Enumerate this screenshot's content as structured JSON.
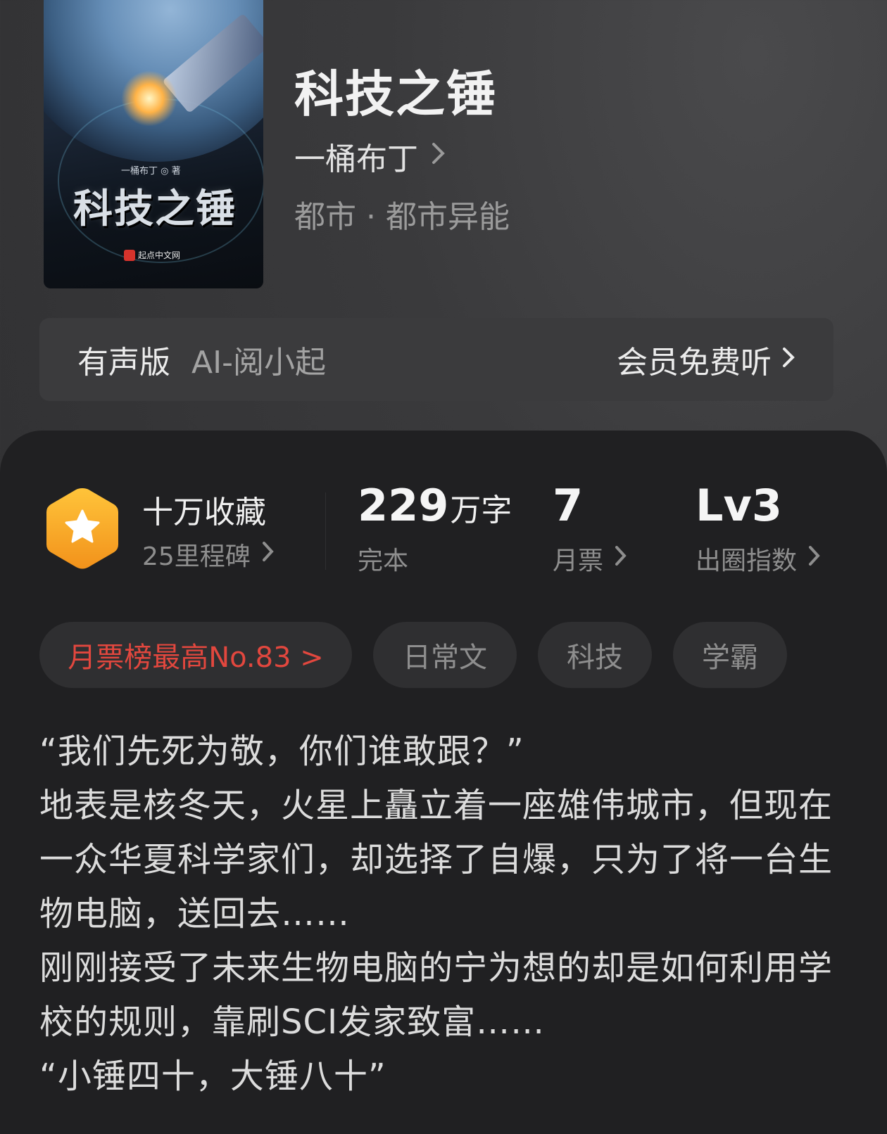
{
  "cover": {
    "author_text": "一桶布丁 ◎ 著",
    "title_text": "科技之锤",
    "publisher": "起点中文网"
  },
  "book": {
    "title": "科技之锤",
    "author": "一桶布丁",
    "genre": "都市 · 都市异能"
  },
  "audio": {
    "label": "有声版",
    "voice": "AI-阅小起",
    "action": "会员免费听"
  },
  "stats": {
    "collection_title": "十万收藏",
    "collection_sub": "25里程碑",
    "words_number": "229",
    "words_unit": "万字",
    "status": "完本",
    "monthly_votes": "7",
    "monthly_label": "月票",
    "level": "Lv3",
    "level_label": "出圈指数"
  },
  "tags": {
    "rank": "月票榜最高No.83 >",
    "items": [
      "日常文",
      "科技",
      "学霸"
    ]
  },
  "synopsis": {
    "lines": [
      "“我们先死为敬，你们谁敢跟？”",
      "地表是核冬天，火星上矗立着一座雄伟城市，但现在一众华夏科学家们，却选择了自爆，只为了将一台生物电脑，送回去……",
      "刚刚接受了未来生物电脑的宁为想的却是如何利用学校的规则，靠刷SCI发家致富……",
      "“小锤四十，大锤八十”"
    ]
  },
  "colors": {
    "accent_red": "#e2473e",
    "badge_orange": "#f6a623"
  }
}
